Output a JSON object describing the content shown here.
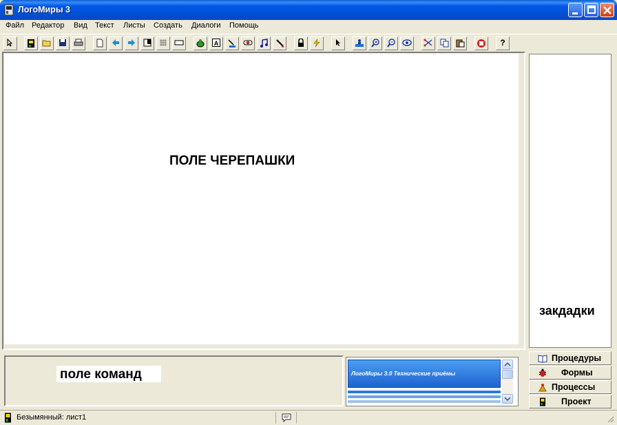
{
  "window": {
    "title": "ЛогоМиры 3"
  },
  "menu": [
    "Файл",
    "Редактор",
    "Вид",
    "Текст",
    "Листы",
    "Создать",
    "Диалоги",
    "Помощь"
  ],
  "toolbar": {
    "icons": [
      "pointer",
      "logo-project",
      "open",
      "save",
      "print",
      "new-page",
      "prev-page",
      "next-page",
      "page-layout",
      "grid",
      "rectangle",
      "turtle",
      "text",
      "paint",
      "button",
      "music",
      "slider",
      "lock",
      "lightning",
      "arrow-cursor",
      "stamp",
      "zoom-in",
      "zoom-out",
      "eye",
      "scissors",
      "copy",
      "paste",
      "stop",
      "help"
    ],
    "help_label": "?"
  },
  "turtle_field": {
    "label": "ПОЛЕ ЧЕРЕПАШКИ"
  },
  "tabs_panel": {
    "label": "закдадки",
    "tabs": [
      {
        "label": "Процедуры",
        "icon": "book-icon"
      },
      {
        "label": "Формы",
        "icon": "bug-icon"
      },
      {
        "label": "Процессы",
        "icon": "process-icon"
      },
      {
        "label": "Проект",
        "icon": "project-icon"
      }
    ]
  },
  "command_field": {
    "label": "поле команд"
  },
  "help_pane": {
    "banner": "ЛогоМиры 3.0 Технические приёмы"
  },
  "status": {
    "name": "Безымянный:  лист1"
  },
  "colors": {
    "titlebar": "#0058e6",
    "chrome": "#ece9d8",
    "banner": "#2b7ad9"
  }
}
